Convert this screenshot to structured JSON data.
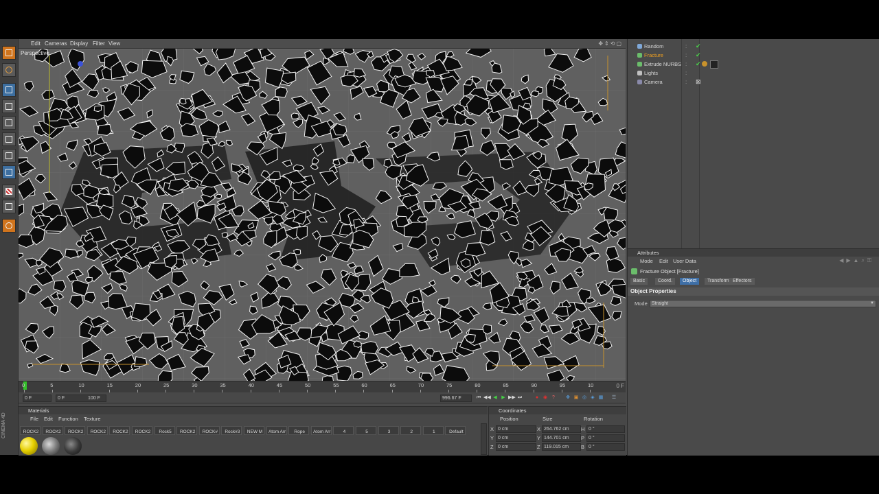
{
  "viewport_menu": [
    "Edit",
    "Cameras",
    "Display",
    "Filter",
    "View"
  ],
  "viewport_label": "Perspective",
  "timeline": {
    "ticks": [
      "0",
      "5",
      "10",
      "15",
      "20",
      "25",
      "30",
      "35",
      "40",
      "45",
      "50",
      "55",
      "60",
      "65",
      "70",
      "75",
      "80",
      "85",
      "90",
      "95",
      "10"
    ],
    "end_frame": "0 F",
    "current_frame": "0 F",
    "start_field": "0 F",
    "range_field": "100 F",
    "fps_field": "996.67 F"
  },
  "materials": {
    "title": "Materials",
    "menu": [
      "File",
      "Edit",
      "Function",
      "Texture"
    ],
    "items": [
      "ROCK2",
      "ROCK2",
      "ROCK2",
      "ROCK2",
      "ROCK2",
      "ROCK2",
      "Rock5",
      "ROCK2",
      "ROCK#",
      "Rock#3",
      "NEW M",
      "Atom Arr",
      "Rope",
      "Atom Arr",
      "4",
      "5",
      "3",
      "2",
      "1",
      "Default"
    ]
  },
  "coordinates": {
    "title": "Coordinates",
    "headers": [
      "Position",
      "Size",
      "Rotation"
    ],
    "rows": [
      {
        "axis": "X",
        "pos": "0 cm",
        "size_axis": "X",
        "size": "264.762 cm",
        "rot_axis": "H",
        "rot": "0 °"
      },
      {
        "axis": "Y",
        "pos": "0 cm",
        "size_axis": "Y",
        "size": "144.701 cm",
        "rot_axis": "P",
        "rot": "0 °"
      },
      {
        "axis": "Z",
        "pos": "0 cm",
        "size_axis": "Z",
        "size": "119.015 cm",
        "rot_axis": "B",
        "rot": "0 °"
      }
    ]
  },
  "objects": [
    {
      "name": "Random",
      "selected": false
    },
    {
      "name": "Fracture",
      "selected": true
    },
    {
      "name": "Extrude NURBS",
      "selected": false
    },
    {
      "name": "Lights",
      "selected": false
    },
    {
      "name": "Camera",
      "selected": false
    }
  ],
  "attributes": {
    "title": "Attributes",
    "menu": [
      "Mode",
      "Edit",
      "User Data"
    ],
    "object_label": "Fracture Object [Fracture]",
    "tabs": [
      "Basic",
      "Coord.",
      "Object",
      "Transform",
      "Effectors"
    ],
    "active_tab": "Object",
    "section": "Object Properties",
    "mode_label": "Mode",
    "mode_value": "Straight"
  },
  "side_brand": "CINEMA 4D",
  "colors": {
    "accent": "#3e6fa7",
    "selection": "#f0a020",
    "playhead": "#34c12a"
  }
}
